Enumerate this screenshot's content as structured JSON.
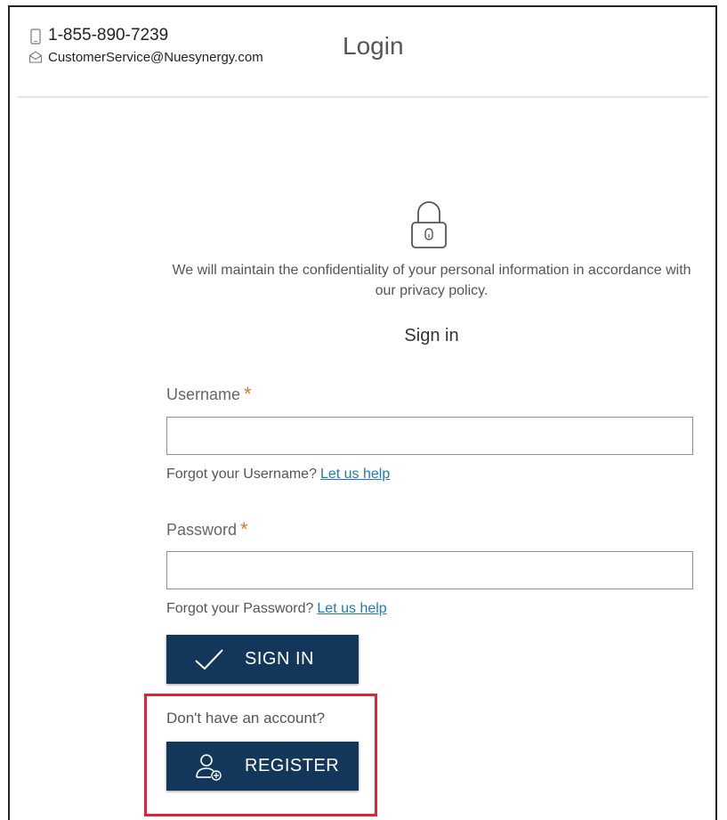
{
  "header": {
    "phone": "1-855-890-7239",
    "email": "CustomerService@Nuesynergy.com",
    "title": "Login",
    "phone_icon": "phone-icon",
    "email_icon": "envelope-icon"
  },
  "main": {
    "lock_icon": "lock-icon",
    "privacy_text": "We will maintain the confidentiality of your personal information in accordance with our privacy policy.",
    "heading": "Sign in",
    "username": {
      "label": "Username",
      "required_mark": "*",
      "value": "",
      "help_text": "Forgot your Username?",
      "help_link": "Let us help"
    },
    "password": {
      "label": "Password",
      "required_mark": "*",
      "value": "",
      "help_text": "Forgot your Password?",
      "help_link": "Let us help"
    },
    "signin_button": {
      "label": "SIGN IN",
      "icon": "checkmark-icon"
    },
    "register_prompt": "Don't have an account?",
    "register_button": {
      "label": "REGISTER",
      "icon": "add-user-icon"
    }
  },
  "colors": {
    "button_bg": "#12375b",
    "link": "#1f7ab8",
    "required": "#d9792b",
    "highlight": "#e02433"
  }
}
